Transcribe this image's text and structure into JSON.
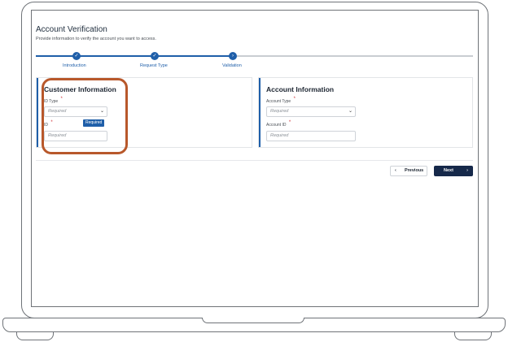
{
  "header": {
    "title": "Account Verification",
    "subtitle": "Provide information to verify the account you want to access."
  },
  "steps": [
    {
      "label": "Introduction",
      "status": "complete",
      "icon": "check-icon"
    },
    {
      "label": "Request Type",
      "status": "complete",
      "icon": "check-icon"
    },
    {
      "label": "Validation",
      "status": "current",
      "icon": "chevron-right-icon"
    }
  ],
  "customer_info": {
    "title": "Customer Information",
    "id_type_label": "ID Type",
    "id_type_placeholder": "Required",
    "id_label": "ID",
    "id_placeholder": "Required",
    "tooltip": "Required"
  },
  "account_info": {
    "title": "Account Information",
    "account_type_label": "Account Type",
    "account_type_placeholder": "Required",
    "account_id_label": "Account ID",
    "account_id_placeholder": "Required"
  },
  "required_marker": "*",
  "buttons": {
    "previous": "Previous",
    "next": "Next",
    "previous_icon": "‹",
    "next_icon": "›"
  },
  "colors": {
    "accent": "#1f5fa9",
    "highlight": "#b8582b",
    "next_button": "#16294a",
    "required": "#d0343a"
  }
}
